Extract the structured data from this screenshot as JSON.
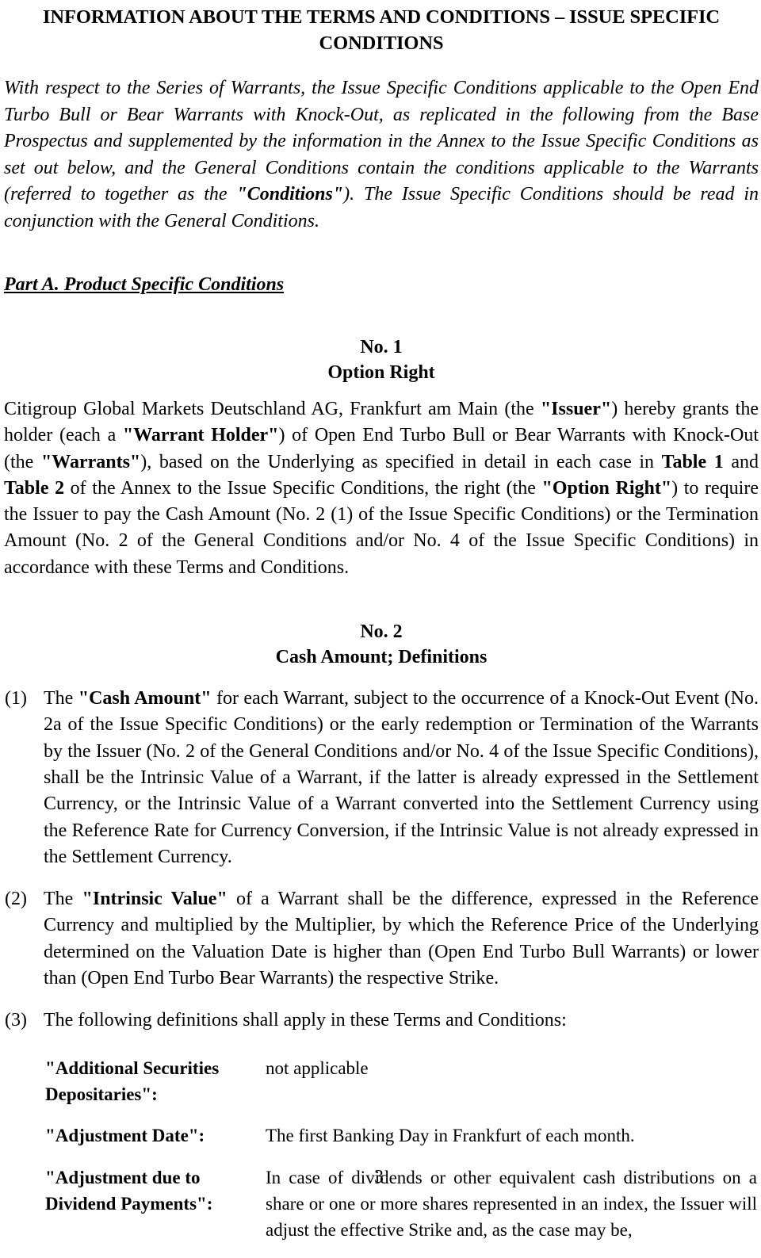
{
  "document": {
    "title": "INFORMATION ABOUT THE TERMS AND CONDITIONS – ISSUE SPECIFIC CONDITIONS",
    "page_number": "3"
  },
  "intro": {
    "part1": "With respect to the Series of Warrants, the Issue Specific Conditions applicable to the Open End Turbo Bull or Bear Warrants with Knock-Out, as replicated in the following from the Base Prospectus and supplemented by the information in the Annex to the Issue Specific Conditions as set out below, and the General Conditions contain the conditions applicable to the Warrants (referred to together as the ",
    "bold_term": "\"Conditions\"",
    "part2": "). The Issue Specific Conditions should be read in conjunction with the General Conditions."
  },
  "part_a": {
    "heading": "Part A. Product Specific Conditions"
  },
  "section_1": {
    "number": "No. 1",
    "title": "Option Right",
    "body": {
      "t1": "Citigroup Global Markets Deutschland AG, Frankfurt am Main (the ",
      "b1": "\"Issuer\"",
      "t2": ") hereby grants the holder (each a ",
      "b2": "\"Warrant Holder\"",
      "t3": ") of Open End Turbo Bull or Bear Warrants with Knock-Out (the ",
      "b3": "\"Warrants\"",
      "t4": "), based on the Underlying as specified in detail in each case in ",
      "b4": "Table 1",
      "t5": " and ",
      "b5": "Table 2",
      "t6": " of the Annex to the Issue Specific Conditions, the right (the ",
      "b6": "\"Option Right\"",
      "t7": ") to require the Issuer to pay the Cash Amount (No. 2 (1) of the Issue Specific Conditions) or the Termination Amount (No. 2 of the General Conditions and/or No. 4 of the Issue Specific Conditions) in accordance with these Terms and Conditions."
    }
  },
  "section_2": {
    "number": "No. 2",
    "title": "Cash Amount; Definitions",
    "items": [
      {
        "marker": "(1)",
        "t1": "The ",
        "b1": "\"Cash Amount\"",
        "t2": " for each Warrant, subject to the occurrence of a Knock-Out Event (No. 2a of the Issue Specific Conditions) or the early redemption or Termination of the Warrants by the Issuer (No. 2 of the General Conditions and/or No. 4 of the Issue Specific Conditions), shall be the Intrinsic Value of a Warrant, if the latter is already expressed in the Settlement Currency, or the Intrinsic Value of a Warrant converted into the Settlement Currency using the Reference Rate for Currency Conversion, if the Intrinsic Value is not already expressed in the Settlement Currency."
      },
      {
        "marker": "(2)",
        "t1": "The ",
        "b1": "\"Intrinsic Value\"",
        "t2": " of a Warrant shall be the difference, expressed in the Reference Currency and multiplied by the Multiplier, by which the Reference Price of the Underlying determined on the Valuation Date is higher than (Open End Turbo Bull Warrants) or lower than (Open End Turbo Bear Warrants) the respective Strike."
      },
      {
        "marker": "(3)",
        "t1": "The following definitions shall apply in these Terms and Conditions:",
        "b1": "",
        "t2": ""
      }
    ],
    "definitions": [
      {
        "term": "\"Additional Securities Depositaries\":",
        "value": "not applicable"
      },
      {
        "term": "\"Adjustment Date\":",
        "value": "The first Banking Day in Frankfurt of each month."
      },
      {
        "term": "\"Adjustment due to Dividend Payments\":",
        "value": "In case of dividends or other equivalent cash distributions on a share or one or more shares represented in an index, the Issuer will adjust the effective Strike and, as the case may be,"
      }
    ]
  }
}
